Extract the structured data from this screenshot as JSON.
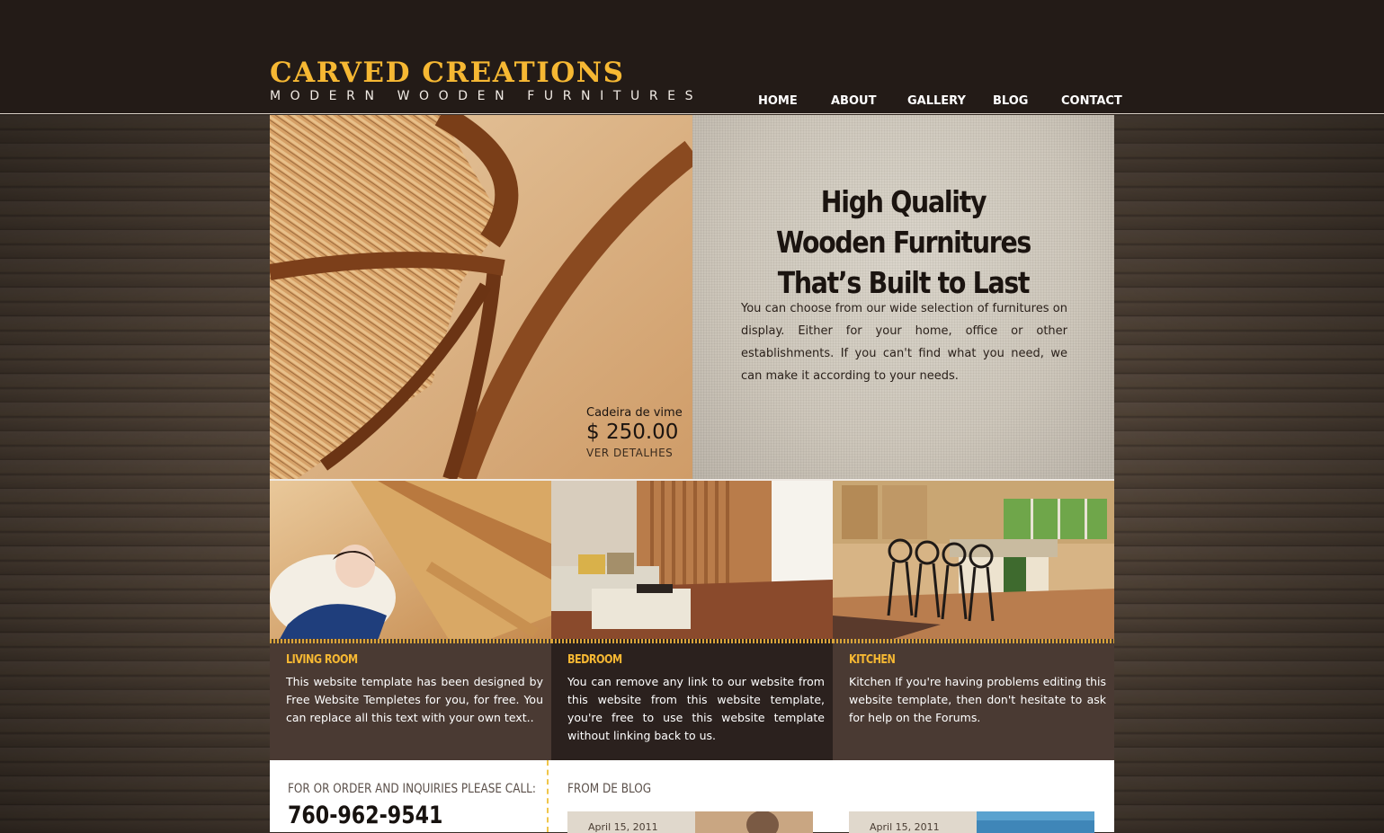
{
  "header": {
    "logo_title": "CARVED CREATIONS",
    "logo_subtitle": "MODERN WOODEN FURNITURES"
  },
  "nav": {
    "items": [
      "HOME",
      "ABOUT",
      "GALLERY",
      "BLOG",
      "CONTACT"
    ]
  },
  "hero": {
    "heading_line1": "High Quality",
    "heading_line2": "Wooden Furnitures",
    "heading_line3": "That’s Built to Last",
    "paragraph": "You can choose from our wide selection of furnitures on display. Either for your home, office or other establishments. If you can't find what you need, we can make it according to your needs.",
    "product_name": "Cadeira de vime",
    "product_price": "$ 250.00",
    "product_link": "VER DETALHES"
  },
  "rooms": [
    {
      "title": "LIVING ROOM",
      "text": "This website template has been designed by Free Website Templetes for you, for free. You can replace all this text with your own text.."
    },
    {
      "title": "BEDROOM",
      "text": "You can remove any link to our website from this website from this website template, you're free to use this website template without linking back to us."
    },
    {
      "title": "KITCHEN",
      "text": "Kitchen If you're having problems editing this website template, then don't hesitate to ask for help on the Forums."
    }
  ],
  "order": {
    "label": "FOR OR ORDER AND INQUIRIES PLEASE CALL:",
    "phone": "760-962-9541"
  },
  "blog": {
    "label": "FROM DE BLOG",
    "posts": [
      {
        "date": "April 15, 2011"
      },
      {
        "date": "April 15, 2011"
      }
    ]
  },
  "colors": {
    "brand_gold": "#f6b833",
    "header_bg": "#231b17",
    "room_dark": "#2b211e",
    "room_mid": "#4a3a33"
  }
}
